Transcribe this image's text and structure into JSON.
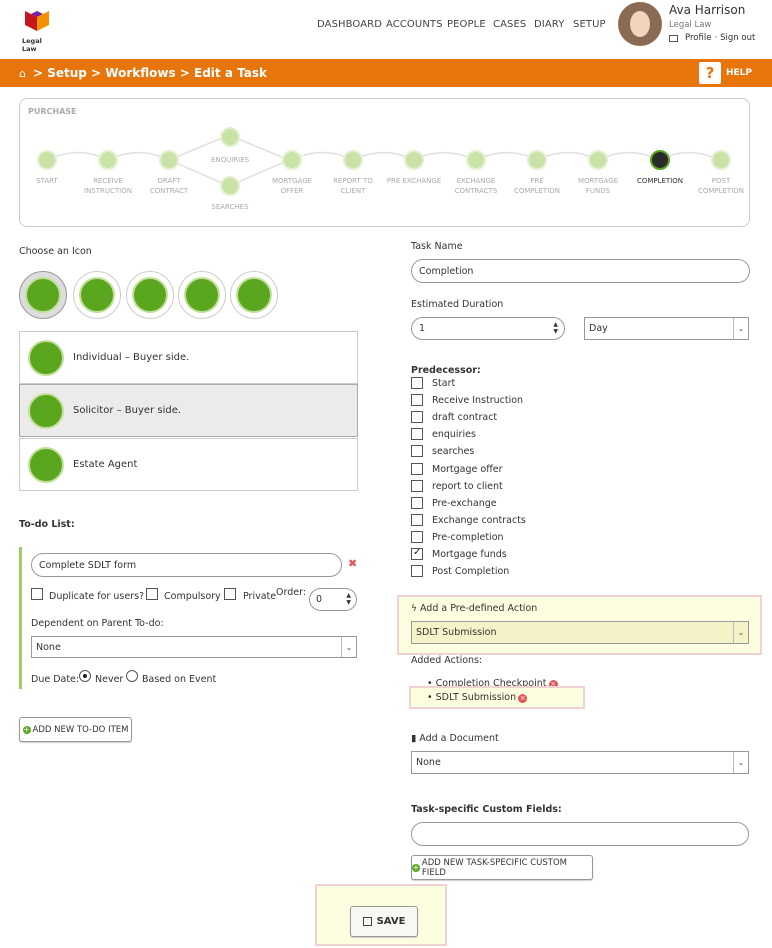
{
  "app": {
    "logo_text": "Legal Law"
  },
  "nav": {
    "items": [
      "DASHBOARD",
      "ACCOUNTS",
      "PEOPLE",
      "CASES",
      "DIARY",
      "SETUP"
    ]
  },
  "user": {
    "name": "Ava Harrison",
    "org": "Legal Law",
    "profile": "Profile",
    "sep": "·",
    "signout": "Sign out"
  },
  "breadcrumb": {
    "text": "> Setup > Workflows > Edit a Task",
    "help": "HELP"
  },
  "workflow": {
    "title": "PURCHASE",
    "stages": [
      "START",
      "RECEIVE INSTRUCTION",
      "DRAFT CONTRACT",
      "ENQUIRIES",
      "SEARCHES",
      "MORTGAGE OFFER",
      "REPORT TO CLIENT",
      "PRE EXCHANGE",
      "EXCHANGE CONTRACTS",
      "PRE COMPLETION",
      "MORTGAGE FUNDS",
      "COMPLETION",
      "POST COMPLETION"
    ],
    "active": "COMPLETION"
  },
  "icons": {
    "label": "Choose an Icon",
    "names": [
      "house-icon",
      "document-icon",
      "scales-icon",
      "search-icon",
      "pound-icon"
    ],
    "selected": "house-icon"
  },
  "personas": [
    {
      "label": "Individual – Buyer side.",
      "selected": false
    },
    {
      "label": "Solicitor – Buyer side.",
      "selected": true
    },
    {
      "label": "Estate Agent",
      "selected": false
    }
  ],
  "todo": {
    "heading": "To-do List:",
    "item_value": "Complete SDLT form",
    "duplicate_label": "Duplicate for users?",
    "compulsory_label": "Compulsory",
    "private_label": "Private",
    "order_label": "Order:",
    "order_value": "0",
    "dependent_label": "Dependent on Parent To-do:",
    "dependent_value": "None",
    "due_label": "Due Date:",
    "never_label": "Never",
    "event_label": "Based on Event",
    "due_selected": "Never",
    "add_button": "ADD NEW TO-DO ITEM"
  },
  "task": {
    "name_label": "Task Name",
    "name_value": "Completion",
    "duration_label": "Estimated Duration",
    "duration_value": "1",
    "duration_unit": "Day"
  },
  "predecessor": {
    "label": "Predecessor:",
    "items": [
      {
        "label": "Start",
        "checked": false
      },
      {
        "label": "Receive Instruction",
        "checked": false
      },
      {
        "label": "draft contract",
        "checked": false
      },
      {
        "label": "enquiries",
        "checked": false
      },
      {
        "label": "searches",
        "checked": false
      },
      {
        "label": "Mortgage offer",
        "checked": false
      },
      {
        "label": "report to client",
        "checked": false
      },
      {
        "label": "Pre-exchange",
        "checked": false
      },
      {
        "label": "Exchange contracts",
        "checked": false
      },
      {
        "label": "Pre-completion",
        "checked": false
      },
      {
        "label": "Mortgage funds",
        "checked": true
      },
      {
        "label": "Post Completion",
        "checked": false
      }
    ]
  },
  "actions": {
    "predefined_label": "Add a Pre-defined Action",
    "predefined_value": "SDLT Submission",
    "added_label": "Added Actions:",
    "added": [
      "Completion Checkpoint",
      "SDLT Submission"
    ]
  },
  "document": {
    "label": "Add a Document",
    "value": "None"
  },
  "custom_fields": {
    "label": "Task-specific Custom Fields:",
    "value": "",
    "add_button": "ADD NEW TASK-SPECIFIC CUSTOM FIELD"
  },
  "save": {
    "label": "SAVE"
  },
  "colors": {
    "accent": "#e8740c",
    "green": "#5aa61e",
    "highlight": "#fdfde0"
  }
}
